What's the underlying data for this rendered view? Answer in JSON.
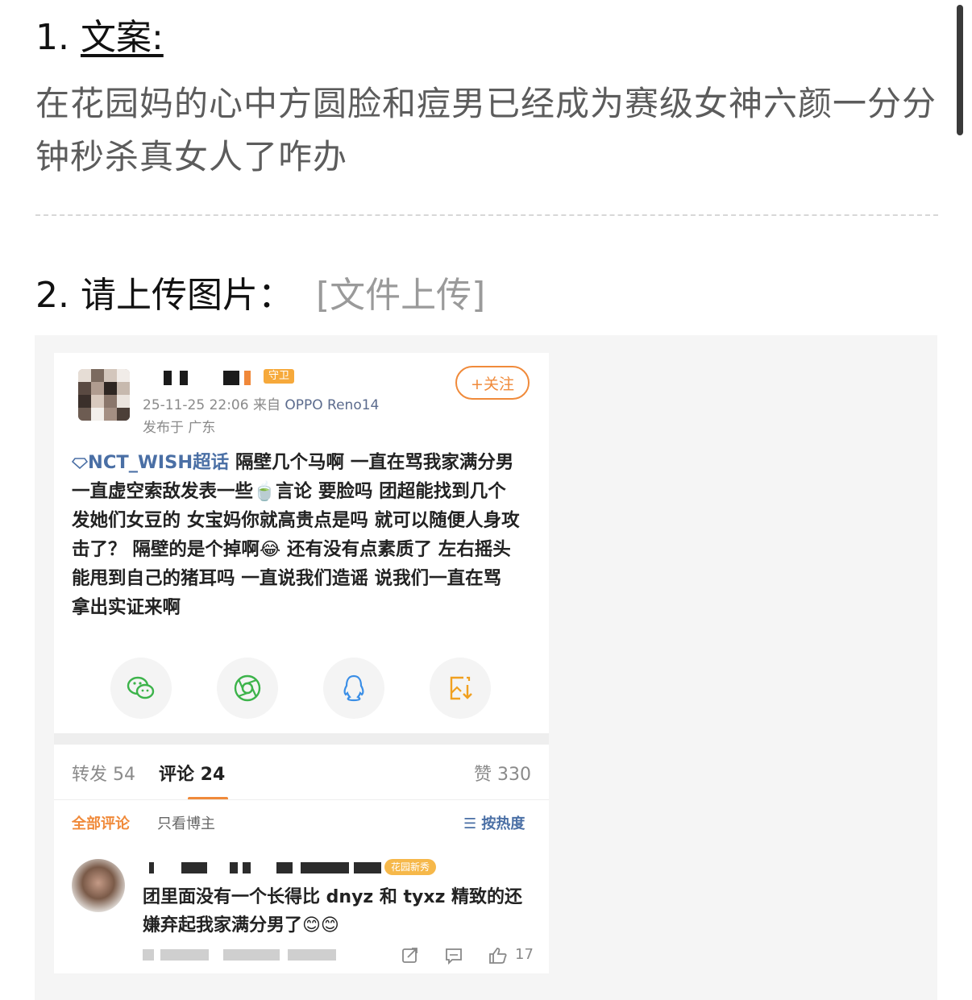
{
  "section1": {
    "number": "1. ",
    "title": "文案:",
    "body": "在花园妈的心中方圆脸和痘男已经成为赛级女神六颜一分分钟秒杀真女人了咋办"
  },
  "section2": {
    "title": "2. 请上传图片：",
    "upload_label": "[文件上传]"
  },
  "weibo_card": {
    "user_badge": "守卫",
    "timestamp": "25-11-25 22:06",
    "source_prefix": "来自",
    "device": "OPPO Reno14",
    "location": "发布于 广东",
    "follow_button": "+关注",
    "topic": "NCT_WISH超话",
    "post_text_1": " 隔壁几个马啊 一直在骂我家满分男 一直虚空索敌发表一些",
    "post_text_2": "言论 要脸吗 团超能找到几个发她们女豆的 女宝妈你就高贵点是吗 就可以随便人身攻击了？ 隔壁的是个掉啊",
    "post_text_3": " 还有没有点素质了 左右摇头能甩到自己的猪耳吗 一直说我们造谣 说我们一直在骂 拿出实证来啊",
    "emoji_tea": "🍵",
    "emoji_laugh": "😂",
    "share_icons": [
      "wechat-icon",
      "moments-icon",
      "qq-icon",
      "save-image-icon"
    ],
    "stats": {
      "repost": "转发 54",
      "comment": "评论 24",
      "like": "赞 330"
    },
    "filters": {
      "all": "全部评论",
      "op_only": "只看博主",
      "sort": "☰ 按热度"
    },
    "comment": {
      "badge": "花园新秀",
      "text": "团里面没有一个长得比 dnyz 和 tyxz 精致的还嫌弃起我家满分男了😊😊",
      "like_count": "17"
    }
  },
  "colors": {
    "accent_orange": "#f08a3a",
    "link_blue": "#4a6fa5"
  }
}
